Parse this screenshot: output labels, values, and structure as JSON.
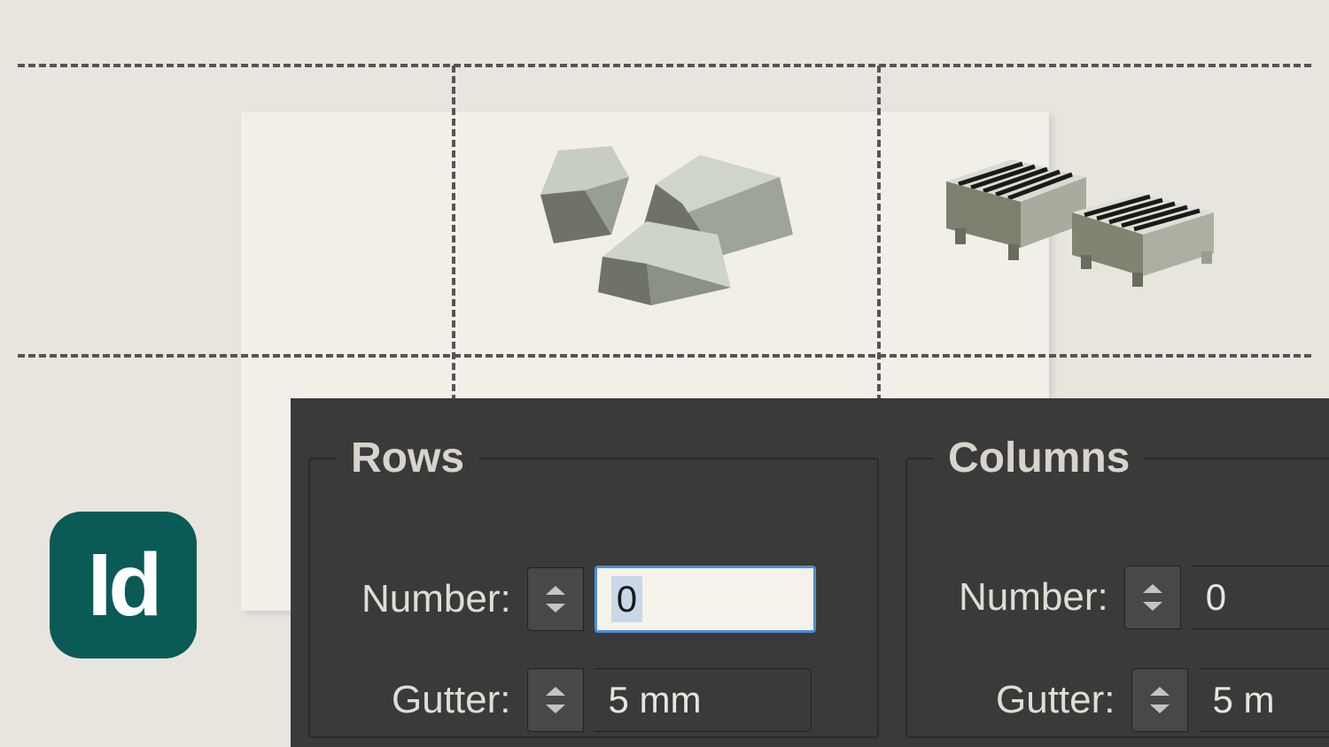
{
  "app_icon_label": "Id",
  "panel": {
    "rows": {
      "legend": "Rows",
      "number_label": "Number:",
      "number_value": "0",
      "gutter_label": "Gutter:",
      "gutter_value": "5 mm"
    },
    "columns": {
      "legend": "Columns",
      "number_label": "Number:",
      "number_value": "0",
      "gutter_label": "Gutter:",
      "gutter_value": "5 m"
    }
  }
}
